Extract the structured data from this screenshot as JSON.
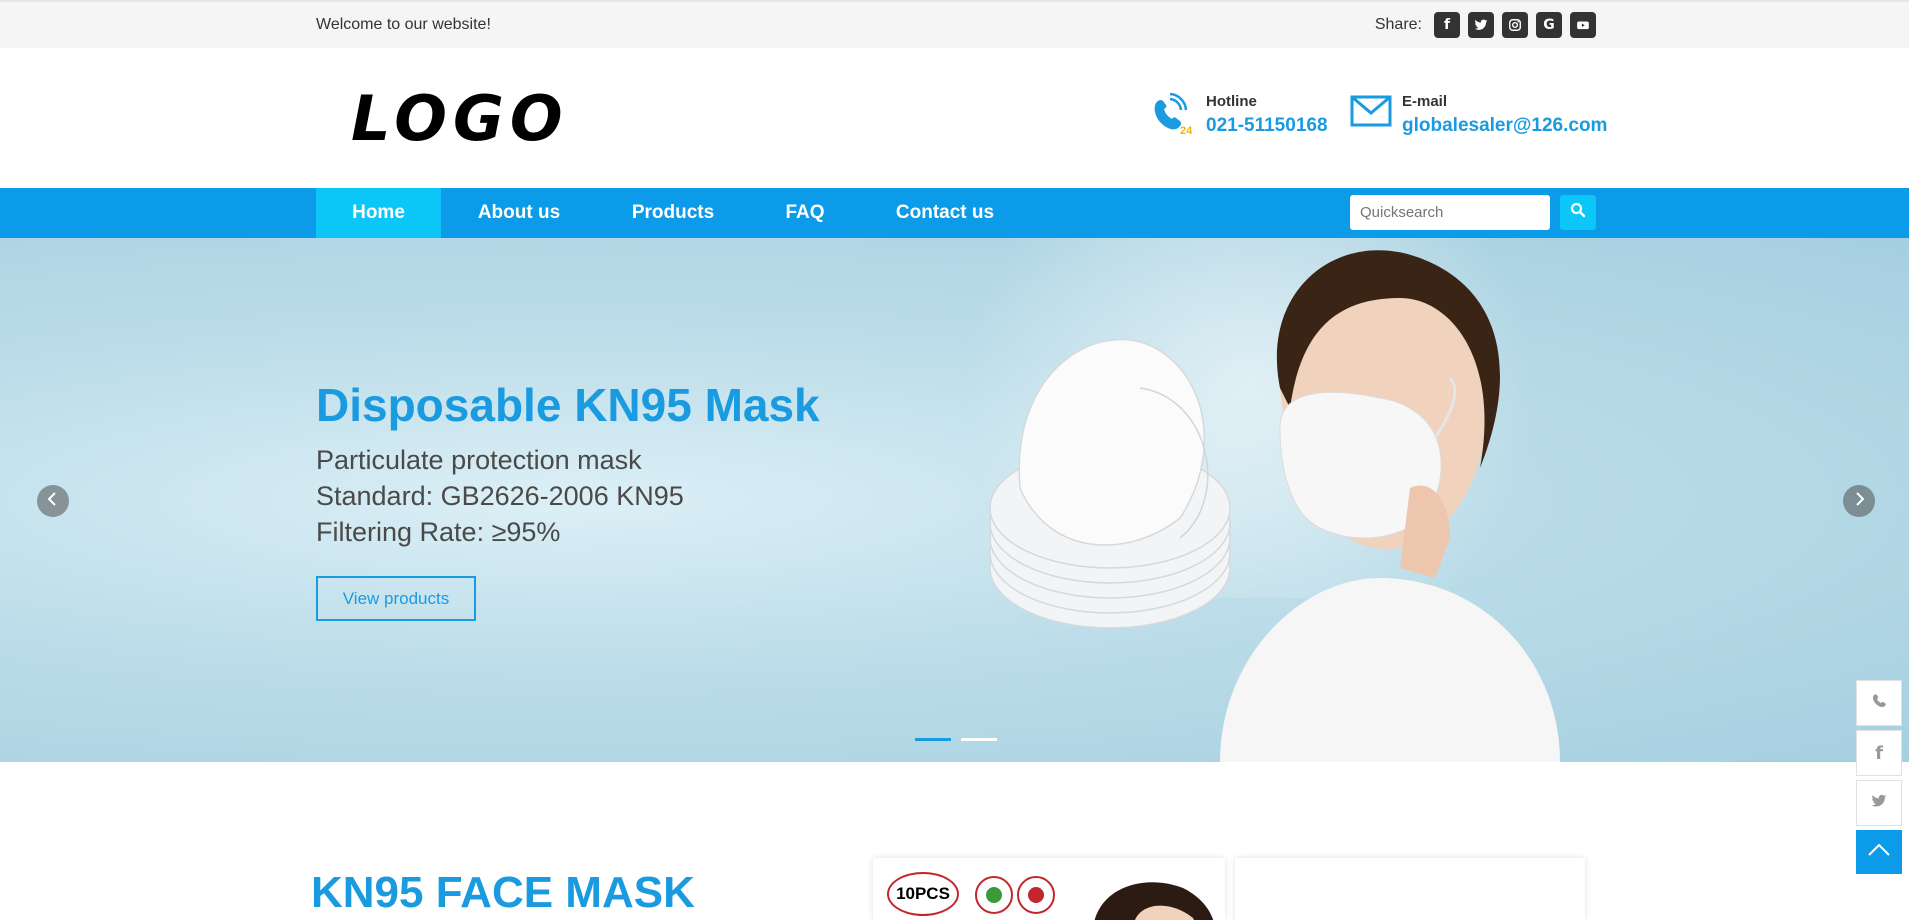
{
  "topbar": {
    "welcome": "Welcome to our website!",
    "share_label": "Share:",
    "social_icons": [
      "facebook-icon",
      "twitter-icon",
      "instagram-icon",
      "google-icon",
      "youtube-icon"
    ]
  },
  "header": {
    "logo": "LOGO",
    "hotline_label": "Hotline",
    "hotline_value": "021-51150168",
    "hotline_badge": "24",
    "email_label": "E-mail",
    "email_value": "globalesaler@126.com"
  },
  "nav": {
    "items": [
      "Home",
      "About us",
      "Products",
      "FAQ",
      "Contact us"
    ],
    "active": "Home",
    "search_placeholder": "Quicksearch"
  },
  "hero": {
    "title": "Disposable KN95 Mask",
    "lines": [
      "Particulate protection mask",
      "Standard: GB2626-2006 KN95",
      "Filtering Rate: ≥95%"
    ],
    "button": "View products",
    "slides_total": 2,
    "slide_active": 1
  },
  "section": {
    "title": "KN95 FACE MASK",
    "card_badge": "10PCS"
  },
  "colors": {
    "accent": "#1a9be0",
    "nav_bg": "#0c9be8",
    "nav_active": "#0bc6f7"
  }
}
